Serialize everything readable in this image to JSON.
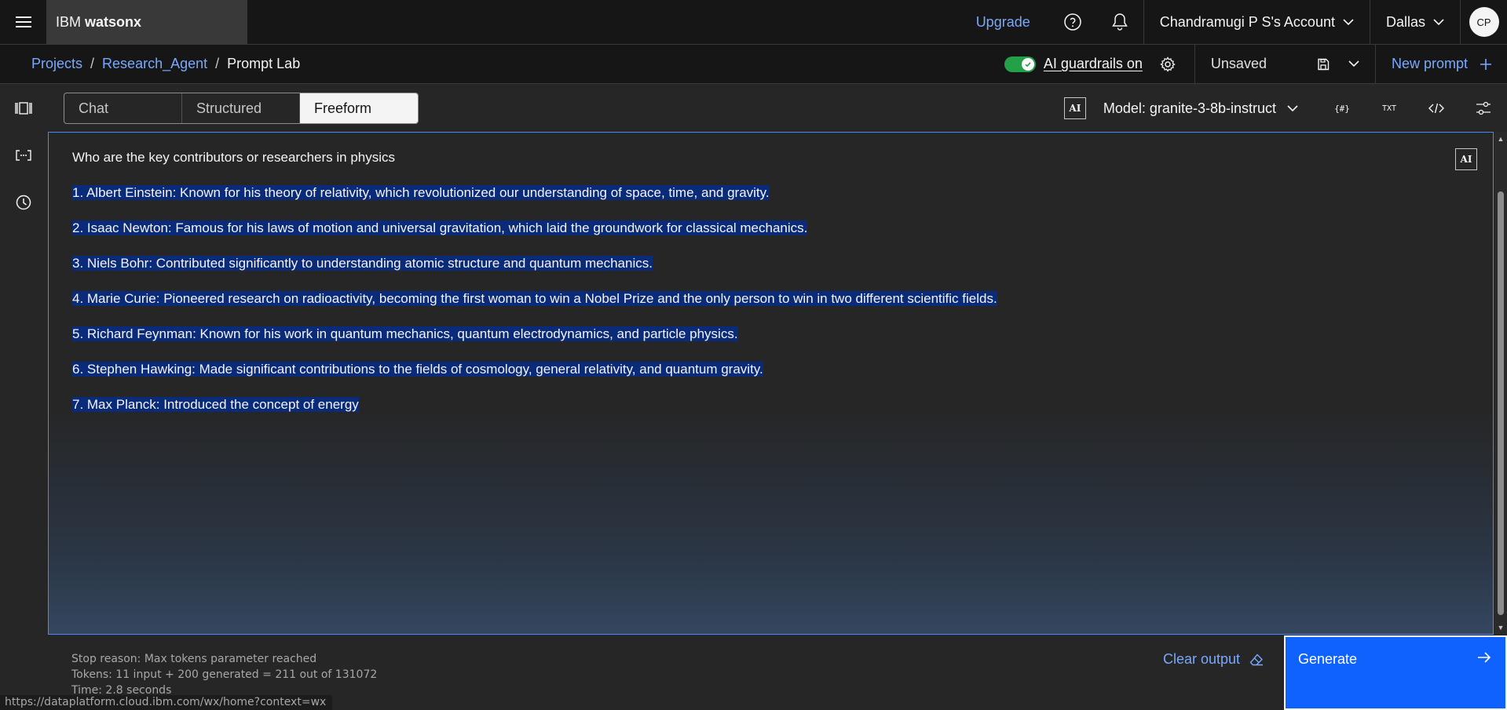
{
  "header": {
    "brand_prefix": "IBM",
    "brand_name": "watsonx",
    "upgrade_label": "Upgrade",
    "account_label": "Chandramugi P S's Account",
    "region_label": "Dallas",
    "avatar_initials": "CP"
  },
  "breadcrumb": {
    "items": [
      "Projects",
      "Research_Agent",
      "Prompt Lab"
    ],
    "separator": "/"
  },
  "guardrails": {
    "label": "AI guardrails on",
    "enabled": true
  },
  "save": {
    "status_label": "Unsaved"
  },
  "new_prompt_label": "New prompt",
  "tabs": [
    {
      "label": "Chat",
      "active": false
    },
    {
      "label": "Structured",
      "active": false
    },
    {
      "label": "Freeform",
      "active": true
    }
  ],
  "model": {
    "badge": "AI",
    "label": "Model: granite-3-8b-instruct"
  },
  "tools": {
    "variables_label": "{#}",
    "txt_label": "TXT"
  },
  "editor": {
    "prompt": "Who are the key contributors or researchers in physics",
    "badge": "AI",
    "output_lines": [
      "1. Albert Einstein: Known for his theory of relativity, which revolutionized our understanding of space, time, and gravity.",
      "2. Isaac Newton: Famous for his laws of motion and universal gravitation, which laid the groundwork for classical mechanics.",
      "3. Niels Bohr: Contributed significantly to understanding atomic structure and quantum mechanics.",
      "4. Marie Curie: Pioneered research on radioactivity, becoming the first woman to win a Nobel Prize and the only person to win in two different scientific fields.",
      "5. Richard Feynman: Known for his work in quantum mechanics, quantum electrodynamics, and particle physics.",
      "6. Stephen Hawking: Made significant contributions to the fields of cosmology, general relativity, and quantum gravity.",
      "7. Max Planck: Introduced the concept of energy"
    ]
  },
  "stats": {
    "stop_reason": "Stop reason: Max tokens parameter reached",
    "tokens": "Tokens: 11 input + 200 generated = 211 out of 131072",
    "time": "Time: 2.8 seconds"
  },
  "actions": {
    "clear_label": "Clear output",
    "generate_label": "Generate"
  },
  "status_url": "https://dataplatform.cloud.ibm.com/wx/home?context=wx",
  "colors": {
    "link": "#78a9ff",
    "primary": "#0f62fe",
    "toggle_on": "#24a148",
    "highlight": "#0a2a7a"
  }
}
